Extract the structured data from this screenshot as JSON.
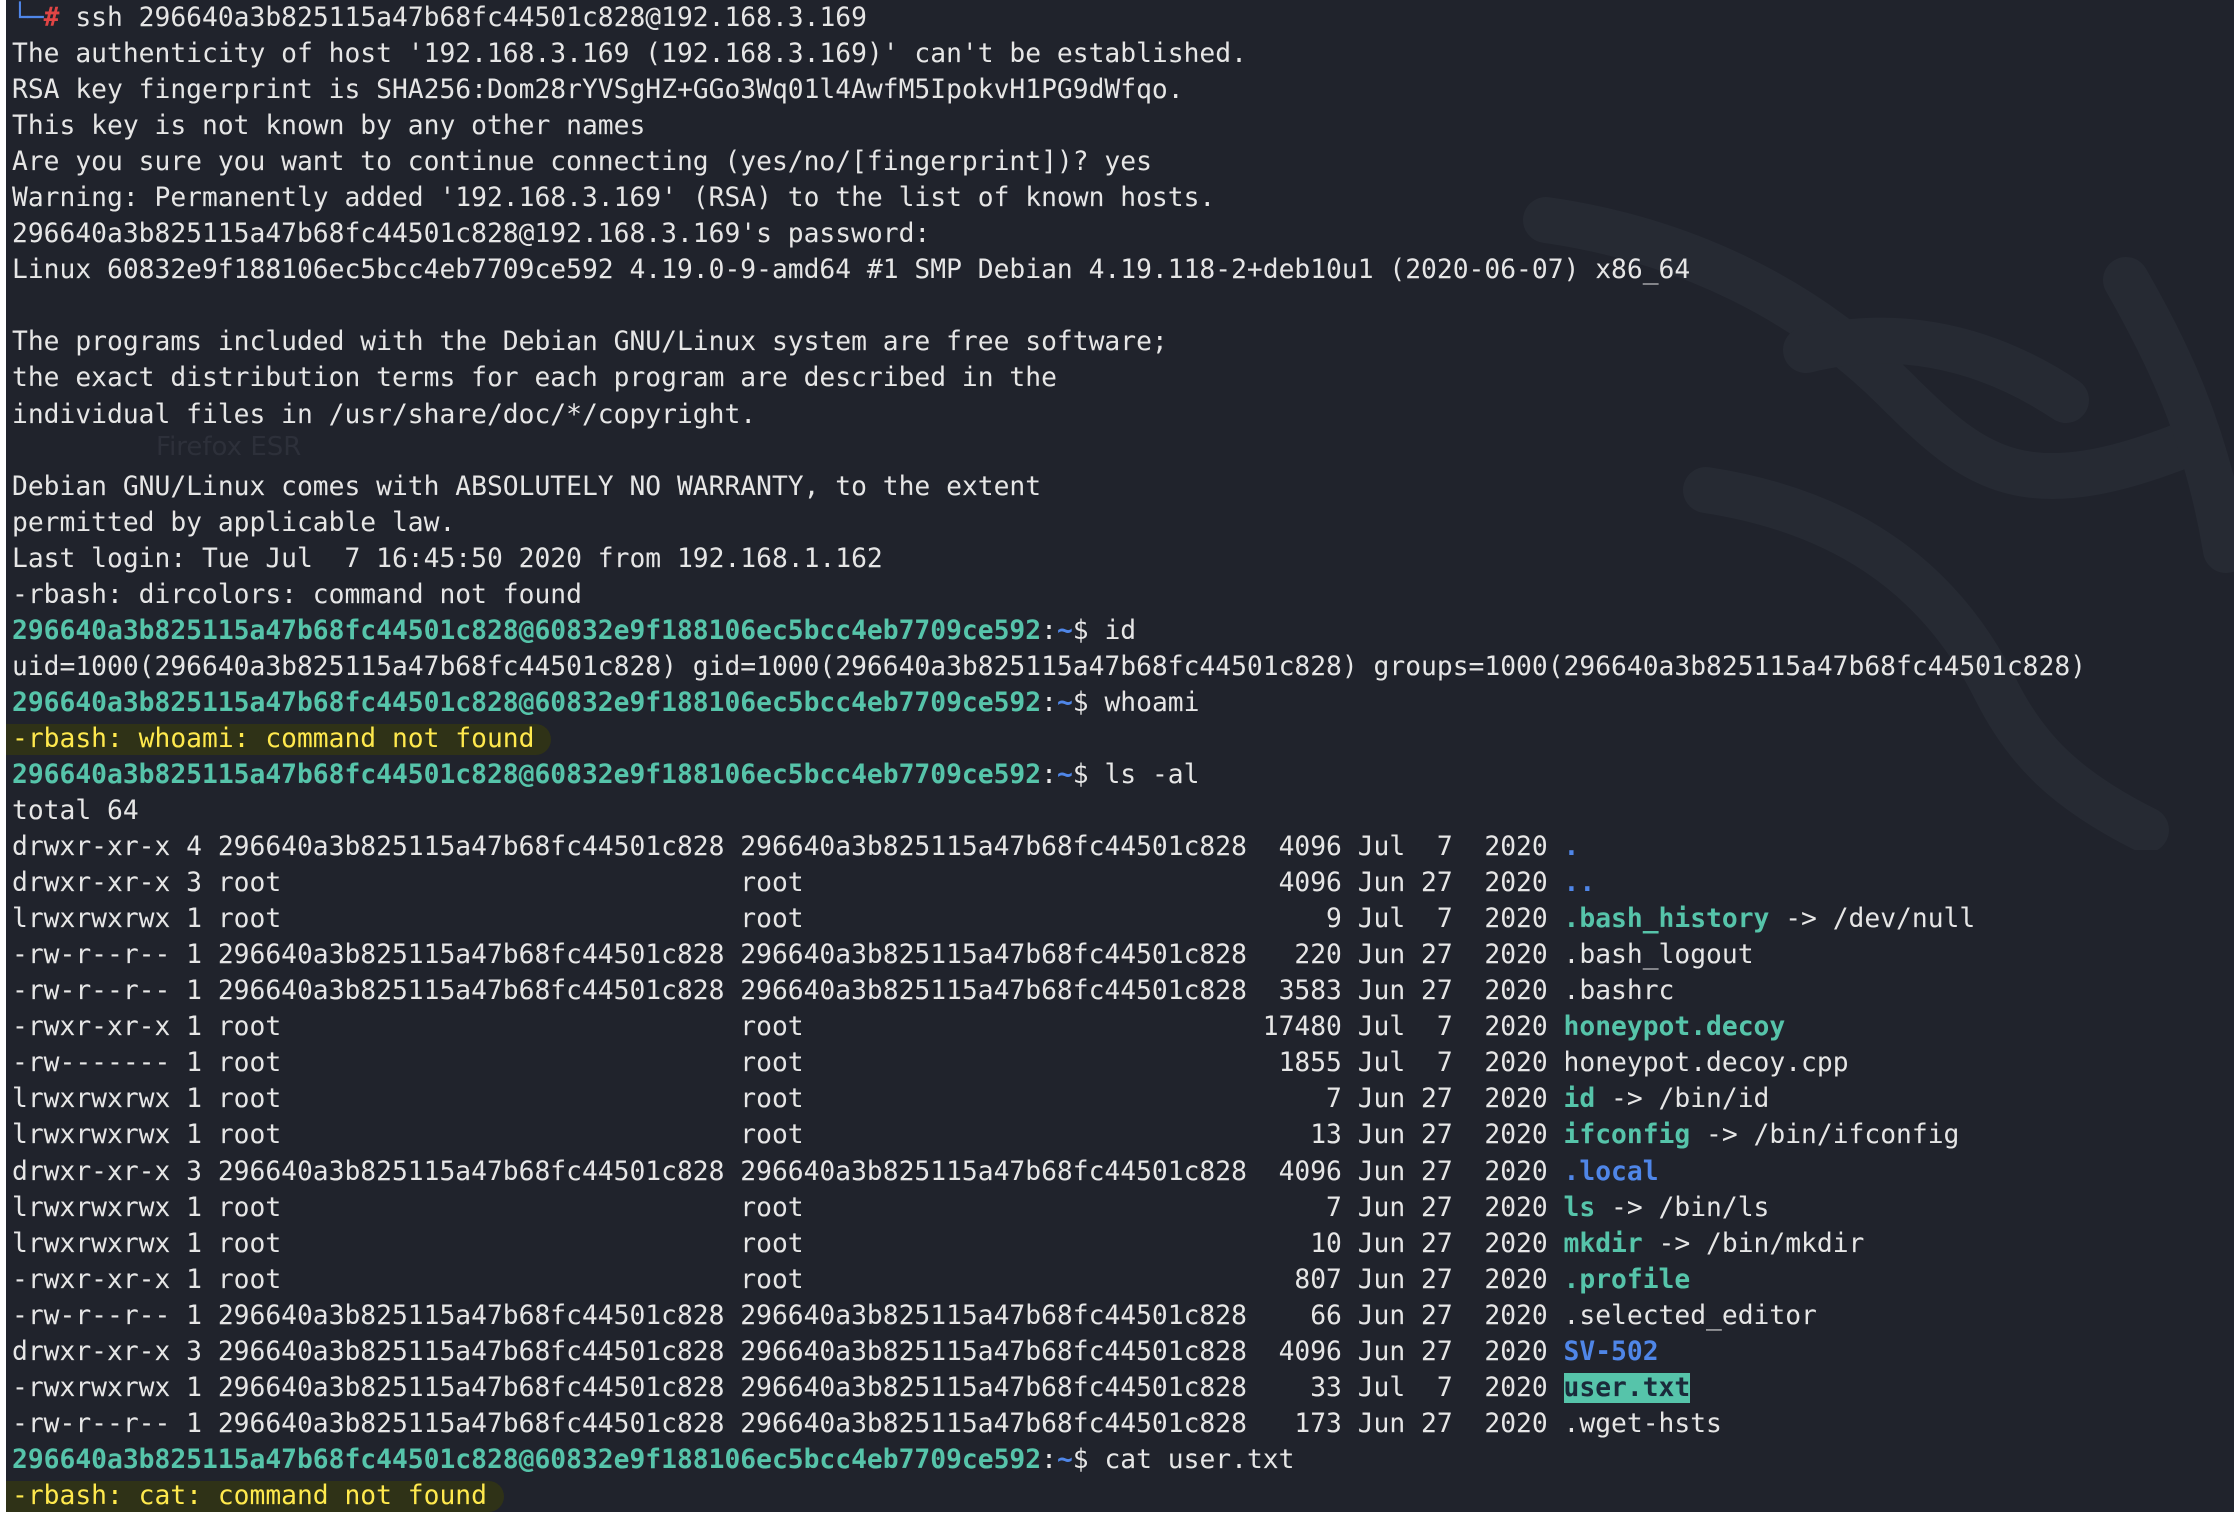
{
  "session": {
    "user_host": "296640a3b825115a47b68fc44501c828@60832e9f188106ec5bcc4eb7709ce592",
    "path": "~",
    "dollar": "$",
    "corner_glyph": "└─",
    "root_hash": "#"
  },
  "lines": [
    {
      "type": "root-cmd",
      "text": " ssh 296640a3b825115a47b68fc44501c828@192.168.3.169"
    },
    {
      "type": "text",
      "text": "The authenticity of host '192.168.3.169 (192.168.3.169)' can't be established."
    },
    {
      "type": "text",
      "text": "RSA key fingerprint is SHA256:Dom28rYVSgHZ+GGo3Wq01l4AwfM5IpokvH1PG9dWfqo."
    },
    {
      "type": "text",
      "text": "This key is not known by any other names"
    },
    {
      "type": "text",
      "text": "Are you sure you want to continue connecting (yes/no/[fingerprint])? yes"
    },
    {
      "type": "text",
      "text": "Warning: Permanently added '192.168.3.169' (RSA) to the list of known hosts."
    },
    {
      "type": "text",
      "text": "296640a3b825115a47b68fc44501c828@192.168.3.169's password:"
    },
    {
      "type": "text",
      "text": "Linux 60832e9f188106ec5bcc4eb7709ce592 4.19.0-9-amd64 #1 SMP Debian 4.19.118-2+deb10u1 (2020-06-07) x86_64"
    },
    {
      "type": "text",
      "text": ""
    },
    {
      "type": "text",
      "text": "The programs included with the Debian GNU/Linux system are free software;"
    },
    {
      "type": "text",
      "text": "the exact distribution terms for each program are described in the"
    },
    {
      "type": "text",
      "text": "individual files in /usr/share/doc/*/copyright."
    },
    {
      "type": "text",
      "text": ""
    },
    {
      "type": "text",
      "text": "Debian GNU/Linux comes with ABSOLUTELY NO WARRANTY, to the extent"
    },
    {
      "type": "text",
      "text": "permitted by applicable law."
    },
    {
      "type": "text",
      "text": "Last login: Tue Jul  7 16:45:50 2020 from 192.168.1.162"
    },
    {
      "type": "text",
      "text": "-rbash: dircolors: command not found"
    },
    {
      "type": "prompt",
      "cmd": " id"
    },
    {
      "type": "text",
      "text": "uid=1000(296640a3b825115a47b68fc44501c828) gid=1000(296640a3b825115a47b68fc44501c828) groups=1000(296640a3b825115a47b68fc44501c828)"
    },
    {
      "type": "prompt",
      "cmd": " whoami"
    },
    {
      "type": "error",
      "text": "-rbash: whoami: command not found"
    },
    {
      "type": "prompt",
      "cmd": " ls -al"
    },
    {
      "type": "text",
      "text": "total 64"
    },
    {
      "type": "ls",
      "meta": "drwxr-xr-x 4 296640a3b825115a47b68fc44501c828 296640a3b825115a47b68fc44501c828  4096 Jul  7  2020 ",
      "name": ".",
      "cls": "dir",
      "suffix": ""
    },
    {
      "type": "ls",
      "meta": "drwxr-xr-x 3 root                             root                              4096 Jun 27  2020 ",
      "name": "..",
      "cls": "dir",
      "suffix": ""
    },
    {
      "type": "ls",
      "meta": "lrwxrwxrwx 1 root                             root                                 9 Jul  7  2020 ",
      "name": ".bash_history",
      "cls": "link",
      "suffix": " -> /dev/null"
    },
    {
      "type": "ls",
      "meta": "-rw-r--r-- 1 296640a3b825115a47b68fc44501c828 296640a3b825115a47b68fc44501c828   220 Jun 27  2020 ",
      "name": ".bash_logout",
      "cls": "plain",
      "suffix": ""
    },
    {
      "type": "ls",
      "meta": "-rw-r--r-- 1 296640a3b825115a47b68fc44501c828 296640a3b825115a47b68fc44501c828  3583 Jun 27  2020 ",
      "name": ".bashrc",
      "cls": "plain",
      "suffix": ""
    },
    {
      "type": "ls",
      "meta": "-rwxr-xr-x 1 root                             root                             17480 Jul  7  2020 ",
      "name": "honeypot.decoy",
      "cls": "exe",
      "suffix": ""
    },
    {
      "type": "ls",
      "meta": "-rw------- 1 root                             root                              1855 Jul  7  2020 ",
      "name": "honeypot.decoy.cpp",
      "cls": "plain",
      "suffix": ""
    },
    {
      "type": "ls",
      "meta": "lrwxrwxrwx 1 root                             root                                 7 Jun 27  2020 ",
      "name": "id",
      "cls": "link",
      "suffix": " -> /bin/id"
    },
    {
      "type": "ls",
      "meta": "lrwxrwxrwx 1 root                             root                                13 Jun 27  2020 ",
      "name": "ifconfig",
      "cls": "link",
      "suffix": " -> /bin/ifconfig"
    },
    {
      "type": "ls",
      "meta": "drwxr-xr-x 3 296640a3b825115a47b68fc44501c828 296640a3b825115a47b68fc44501c828  4096 Jun 27  2020 ",
      "name": ".local",
      "cls": "dir",
      "suffix": ""
    },
    {
      "type": "ls",
      "meta": "lrwxrwxrwx 1 root                             root                                 7 Jun 27  2020 ",
      "name": "ls",
      "cls": "link",
      "suffix": " -> /bin/ls"
    },
    {
      "type": "ls",
      "meta": "lrwxrwxrwx 1 root                             root                                10 Jun 27  2020 ",
      "name": "mkdir",
      "cls": "link",
      "suffix": " -> /bin/mkdir"
    },
    {
      "type": "ls",
      "meta": "-rwxr-xr-x 1 root                             root                               807 Jun 27  2020 ",
      "name": ".profile",
      "cls": "exe",
      "suffix": ""
    },
    {
      "type": "ls",
      "meta": "-rw-r--r-- 1 296640a3b825115a47b68fc44501c828 296640a3b825115a47b68fc44501c828    66 Jun 27  2020 ",
      "name": ".selected_editor",
      "cls": "plain",
      "suffix": ""
    },
    {
      "type": "ls",
      "meta": "drwxr-xr-x 3 296640a3b825115a47b68fc44501c828 296640a3b825115a47b68fc44501c828  4096 Jun 27  2020 ",
      "name": "SV-502",
      "cls": "dir",
      "suffix": ""
    },
    {
      "type": "ls",
      "meta": "-rwxrwxrwx 1 296640a3b825115a47b68fc44501c828 296640a3b825115a47b68fc44501c828    33 Jul  7  2020 ",
      "name": "user.txt",
      "cls": "owr",
      "suffix": ""
    },
    {
      "type": "ls",
      "meta": "-rw-r--r-- 1 296640a3b825115a47b68fc44501c828 296640a3b825115a47b68fc44501c828   173 Jun 27  2020 ",
      "name": ".wget-hsts",
      "cls": "plain",
      "suffix": ""
    },
    {
      "type": "prompt",
      "cmd": " cat user.txt"
    },
    {
      "type": "error",
      "text": "-rbash: cat: command not found"
    }
  ],
  "background": {
    "ghost_label": "Firefox ESR",
    "dragon_icon": "kali-dragon-watermark-icon"
  },
  "colors": {
    "background": "#20232c",
    "foreground": "#e6e6e6",
    "prompt_user": "#56c4aa",
    "prompt_path": "#4f86e8",
    "error_text": "#ffe94d",
    "error_highlight": "#2f3217",
    "directory": "#4f86e8",
    "symlink": "#56c4aa",
    "other_writable_bg": "#56c4aa"
  }
}
